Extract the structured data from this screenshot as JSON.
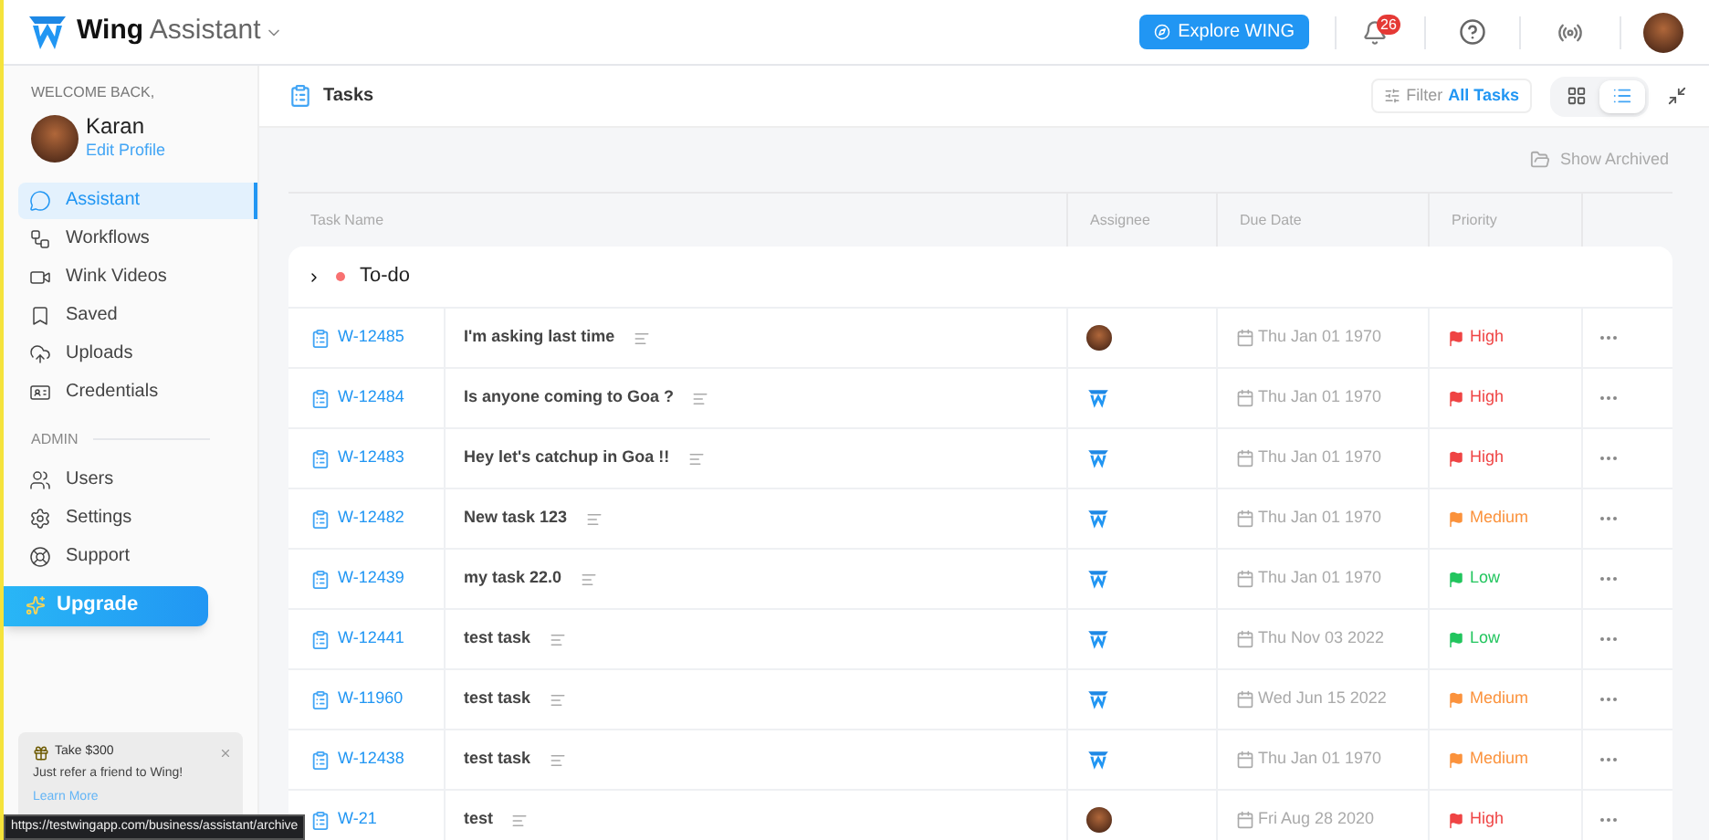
{
  "app": {
    "brand_bold": "Wing",
    "brand_light": "Assistant"
  },
  "topbar": {
    "explore_button": "Explore WING",
    "notification_count": "26"
  },
  "sidebar": {
    "welcome": "WELCOME BACK,",
    "user_name": "Karan",
    "edit_profile": "Edit Profile",
    "items": [
      {
        "label": "Assistant",
        "kind": "chat",
        "selected": true
      },
      {
        "label": "Workflows",
        "kind": "workflow",
        "selected": false
      },
      {
        "label": "Wink Videos",
        "kind": "video",
        "selected": false
      },
      {
        "label": "Saved",
        "kind": "bookmark",
        "selected": false
      },
      {
        "label": "Uploads",
        "kind": "upload",
        "selected": false
      },
      {
        "label": "Credentials",
        "kind": "id",
        "selected": false
      }
    ],
    "admin_heading": "ADMIN",
    "admin_items": [
      {
        "label": "Users",
        "kind": "users",
        "selected": false
      },
      {
        "label": "Settings",
        "kind": "settings",
        "selected": false
      },
      {
        "label": "Support",
        "kind": "support",
        "selected": false
      }
    ],
    "upgrade_button": "Upgrade",
    "promo": {
      "title": "Take $300",
      "text": "Just refer a friend to Wing!",
      "link": "Learn More"
    }
  },
  "page": {
    "title": "Tasks",
    "filter_label": "Filter",
    "filter_value": "All Tasks",
    "views": [
      {
        "kind": "grid",
        "selected": false
      },
      {
        "kind": "list",
        "selected": true
      }
    ],
    "show_archived": "Show Archived"
  },
  "table": {
    "columns": [
      "Task Name",
      "Assignee",
      "Due Date",
      "Priority"
    ],
    "group": {
      "label": "To-do",
      "color": "#f87171",
      "expanded": false
    },
    "rows": [
      {
        "id": "W-12485",
        "name": "I'm asking last time",
        "kind": "avatar",
        "due": "Thu Jan 01 1970",
        "priority": "High",
        "color": "#ef4444"
      },
      {
        "id": "W-12484",
        "name": "Is anyone coming to Goa ?",
        "kind": "logo",
        "due": "Thu Jan 01 1970",
        "priority": "High",
        "color": "#ef4444"
      },
      {
        "id": "W-12483",
        "name": "Hey let's catchup in Goa !!",
        "kind": "logo",
        "due": "Thu Jan 01 1970",
        "priority": "High",
        "color": "#ef4444"
      },
      {
        "id": "W-12482",
        "name": "New task 123",
        "kind": "logo",
        "due": "Thu Jan 01 1970",
        "priority": "Medium",
        "color": "#fb923c"
      },
      {
        "id": "W-12439",
        "name": "my task 22.0",
        "kind": "logo",
        "due": "Thu Jan 01 1970",
        "priority": "Low",
        "color": "#22c55e"
      },
      {
        "id": "W-12441",
        "name": "test task",
        "kind": "logo",
        "due": "Thu Nov 03 2022",
        "priority": "Low",
        "color": "#22c55e"
      },
      {
        "id": "W-11960",
        "name": "test task",
        "kind": "logo",
        "due": "Wed Jun 15 2022",
        "priority": "Medium",
        "color": "#fb923c"
      },
      {
        "id": "W-12438",
        "name": "test task",
        "kind": "logo",
        "due": "Thu Jan 01 1970",
        "priority": "Medium",
        "color": "#fb923c"
      },
      {
        "id": "W-21",
        "name": "test",
        "kind": "avatar",
        "due": "Fri Aug 28 2020",
        "priority": "High",
        "color": "#ef4444"
      }
    ]
  },
  "status_bar": {
    "url": "https://testwingapp.com/business/assistant/archive"
  }
}
